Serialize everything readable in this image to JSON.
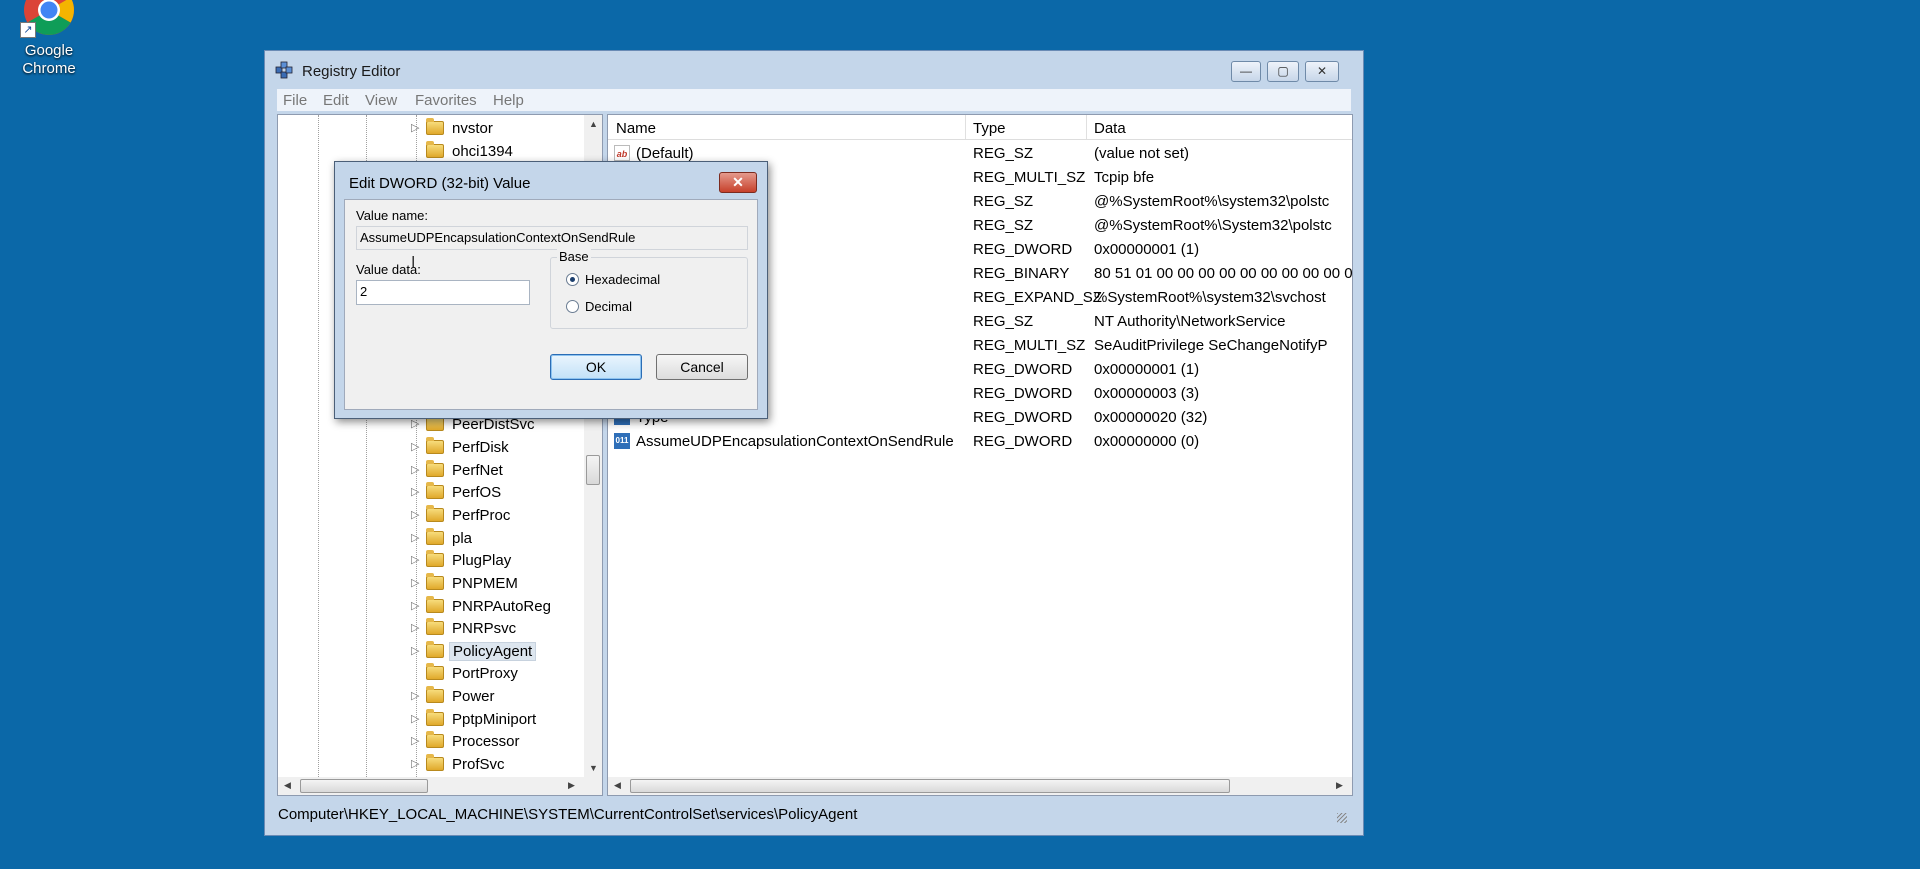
{
  "desktop": {
    "chrome_label": "Google\nChrome"
  },
  "window": {
    "title": "Registry Editor",
    "buttons": {
      "minimize": "—",
      "maximize": "▢",
      "close": "✕"
    }
  },
  "menubar": [
    "File",
    "Edit",
    "View",
    "Favorites",
    "Help"
  ],
  "tree": [
    {
      "label": "nvstor",
      "expandable": true
    },
    {
      "label": "ohci1394",
      "expandable": false
    },
    {
      "label": "PeerDistSvc",
      "expandable": true
    },
    {
      "label": "PerfDisk",
      "expandable": true
    },
    {
      "label": "PerfNet",
      "expandable": true
    },
    {
      "label": "PerfOS",
      "expandable": true
    },
    {
      "label": "PerfProc",
      "expandable": true
    },
    {
      "label": "pla",
      "expandable": true
    },
    {
      "label": "PlugPlay",
      "expandable": true
    },
    {
      "label": "PNPMEM",
      "expandable": true
    },
    {
      "label": "PNRPAutoReg",
      "expandable": true
    },
    {
      "label": "PNRPsvc",
      "expandable": true
    },
    {
      "label": "PolicyAgent",
      "expandable": true,
      "selected": true
    },
    {
      "label": "PortProxy",
      "expandable": false
    },
    {
      "label": "Power",
      "expandable": true
    },
    {
      "label": "PptpMiniport",
      "expandable": true
    },
    {
      "label": "Processor",
      "expandable": true
    },
    {
      "label": "ProfSvc",
      "expandable": true
    }
  ],
  "list": {
    "columns": {
      "name": "Name",
      "type": "Type",
      "data": "Data"
    },
    "rows": [
      {
        "name": "(Default)",
        "type": "REG_SZ",
        "data": "(value not set)",
        "icon": "ab"
      },
      {
        "name": "",
        "type": "REG_MULTI_SZ",
        "data": "Tcpip bfe",
        "icon": "ab"
      },
      {
        "name": "",
        "type": "REG_SZ",
        "data": "@%SystemRoot%\\system32\\polstc",
        "icon": "ab"
      },
      {
        "name": "",
        "type": "REG_SZ",
        "data": "@%SystemRoot%\\System32\\polstc",
        "icon": "ab"
      },
      {
        "name": "",
        "type": "REG_DWORD",
        "data": "0x00000001 (1)",
        "icon": "bin"
      },
      {
        "name": "",
        "type": "REG_BINARY",
        "data": "80 51 01 00 00 00 00 00 00 00 00 00 0",
        "icon": "bin"
      },
      {
        "name": "",
        "type": "REG_EXPAND_SZ",
        "data": "%SystemRoot%\\system32\\svchost",
        "icon": "ab"
      },
      {
        "name": "",
        "type": "REG_SZ",
        "data": "NT Authority\\NetworkService",
        "icon": "ab"
      },
      {
        "name": "",
        "type": "REG_MULTI_SZ",
        "data": "SeAuditPrivilege SeChangeNotifyP",
        "icon": "ab"
      },
      {
        "name": "",
        "type": "REG_DWORD",
        "data": "0x00000001 (1)",
        "icon": "bin"
      },
      {
        "name": "",
        "type": "REG_DWORD",
        "data": "0x00000003 (3)",
        "icon": "bin"
      },
      {
        "name": "Type",
        "type": "REG_DWORD",
        "data": "0x00000020 (32)",
        "icon": "bin"
      },
      {
        "name": "AssumeUDPEncapsulationContextOnSendRule",
        "type": "REG_DWORD",
        "data": "0x00000000 (0)",
        "icon": "bin"
      }
    ]
  },
  "statusbar": {
    "path": "Computer\\HKEY_LOCAL_MACHINE\\SYSTEM\\CurrentControlSet\\services\\PolicyAgent"
  },
  "dialog": {
    "title": "Edit DWORD (32-bit) Value",
    "close": "✕",
    "value_name_label": "Value name:",
    "value_name": "AssumeUDPEncapsulationContextOnSendRule",
    "value_data_label": "Value data:",
    "value_data": "2",
    "base_label": "Base",
    "base_options": [
      "Hexadecimal",
      "Decimal"
    ],
    "base_selected": "Hexadecimal",
    "ok_label": "OK",
    "cancel_label": "Cancel"
  },
  "colors": {
    "desktop": "#0b68a8",
    "window_frame": "#c4d6ea",
    "selection": "#dde6ef"
  }
}
